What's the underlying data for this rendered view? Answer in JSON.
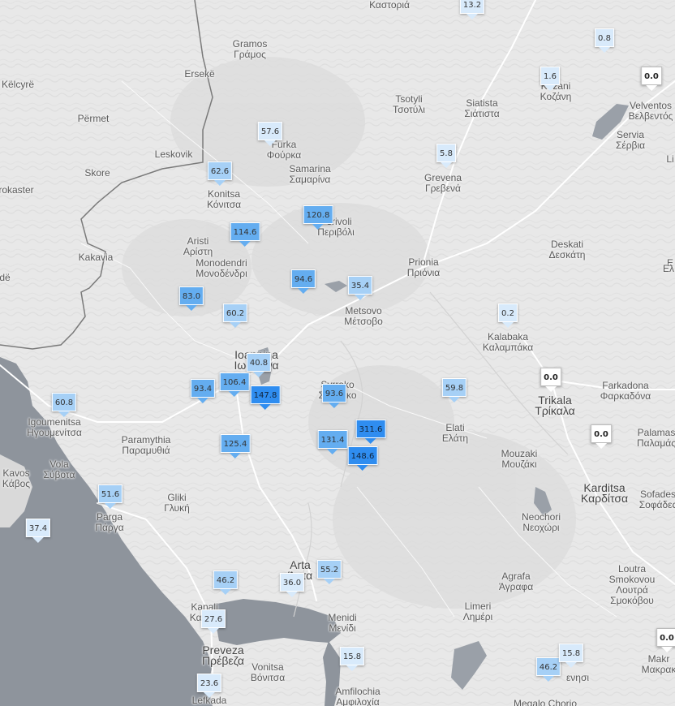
{
  "colors": {
    "land": "#e8e8e8",
    "sea": "#8e949c",
    "water": "#9aa0a8",
    "border": "#7a7a7a",
    "road": "#ffffff",
    "rain_zero": "#ffffff",
    "rain_low": "#d8eafb",
    "rain_mid": "#a6d0f6",
    "rain_high": "#64adf0",
    "rain_max": "#2f8df0"
  },
  "places": [
    {
      "id": "gramos",
      "lines": [
        "Gramos",
        "Γράμος"
      ]
    },
    {
      "id": "ersekë",
      "lines": [
        "Ersekë"
      ]
    },
    {
      "id": "kelcyre",
      "lines": [
        "Këlcyrë"
      ]
    },
    {
      "id": "permet",
      "lines": [
        "Përmet"
      ]
    },
    {
      "id": "leskovik",
      "lines": [
        "Leskovik"
      ]
    },
    {
      "id": "skore",
      "lines": [
        "Skore"
      ]
    },
    {
      "id": "rokaster",
      "lines": [
        "rokaster"
      ]
    },
    {
      "id": "kakavia",
      "lines": [
        "Kakavia"
      ]
    },
    {
      "id": "de",
      "lines": [
        "dë"
      ]
    },
    {
      "id": "furka",
      "lines": [
        "Furka",
        "Φούρκα"
      ]
    },
    {
      "id": "samarina",
      "lines": [
        "Samarina",
        "Σαμαρίνα"
      ]
    },
    {
      "id": "konitsa",
      "lines": [
        "Konitsa",
        "Κόνιτσα"
      ]
    },
    {
      "id": "aristi",
      "lines": [
        "Aristi",
        "Αρίστη"
      ]
    },
    {
      "id": "monodendri",
      "lines": [
        "Monodendri",
        "Μονοδένδρι"
      ]
    },
    {
      "id": "perivoli",
      "lines": [
        "Perivoli",
        "Περιβόλι"
      ]
    },
    {
      "id": "tsotyli",
      "lines": [
        "Tsotyli",
        "Τσοτύλι"
      ]
    },
    {
      "id": "siatista",
      "lines": [
        "Siatista",
        "Σιάτιστα"
      ]
    },
    {
      "id": "kozani",
      "lines": [
        "Kozani",
        "Κοζάνη"
      ]
    },
    {
      "id": "velventos",
      "lines": [
        "Velventos",
        "Βελβεντός"
      ]
    },
    {
      "id": "servia",
      "lines": [
        "Servia",
        "Σέρβια"
      ]
    },
    {
      "id": "grevena",
      "lines": [
        "Grevena",
        "Γρεβενά"
      ]
    },
    {
      "id": "deskati",
      "lines": [
        "Deskati",
        "Δεσκάτη"
      ]
    },
    {
      "id": "prionia",
      "lines": [
        "Prionia",
        "Πριόνια"
      ]
    },
    {
      "id": "metsovo",
      "lines": [
        "Metsovo",
        "Μέτσοβο"
      ]
    },
    {
      "id": "kalabaka",
      "lines": [
        "Kalabaka",
        "Καλαμπάκα"
      ]
    },
    {
      "id": "ioannina",
      "lines": [
        "Ioannina",
        "Ιωάννινα"
      ],
      "big": true
    },
    {
      "id": "syrrako",
      "lines": [
        "Syrrako",
        "Συρράκο"
      ]
    },
    {
      "id": "trikala",
      "lines": [
        "Trikala",
        "Τρίκαλα"
      ],
      "big": true
    },
    {
      "id": "farkadona",
      "lines": [
        "Farkadona",
        "Φαρκαδόνα"
      ]
    },
    {
      "id": "elati",
      "lines": [
        "Elati",
        "Ελάτη"
      ]
    },
    {
      "id": "igoumenitsa",
      "lines": [
        "Igoumenitsa",
        "Ηγουμενίτσα"
      ]
    },
    {
      "id": "paramythia",
      "lines": [
        "Paramythia",
        "Παραμυθιά"
      ]
    },
    {
      "id": "mouzaki",
      "lines": [
        "Mouzaki",
        "Μουζάκι"
      ]
    },
    {
      "id": "palamas",
      "lines": [
        "Palamas",
        "Παλαμάς"
      ]
    },
    {
      "id": "karditsa",
      "lines": [
        "Karditsa",
        "Καρδίτσα"
      ],
      "big": true
    },
    {
      "id": "sofades",
      "lines": [
        "Sofades",
        "Σοφάδες"
      ]
    },
    {
      "id": "kavos",
      "lines": [
        "Kavos",
        "Κάβος"
      ]
    },
    {
      "id": "vola",
      "lines": [
        "Vola",
        "Σύβοτα"
      ]
    },
    {
      "id": "parga",
      "lines": [
        "Parga",
        "Πάργα"
      ]
    },
    {
      "id": "gliki",
      "lines": [
        "Gliki",
        "Γλυκή"
      ]
    },
    {
      "id": "neochori",
      "lines": [
        "Neochori",
        "Νεοχώρι"
      ]
    },
    {
      "id": "arta",
      "lines": [
        "Arta",
        "Άρτα"
      ],
      "big": true
    },
    {
      "id": "kanali",
      "lines": [
        "Kanali",
        "Καναλι"
      ]
    },
    {
      "id": "menidi",
      "lines": [
        "Menidi",
        "Μενίδι"
      ]
    },
    {
      "id": "agrafa",
      "lines": [
        "Agrafa",
        "Άγραφα"
      ]
    },
    {
      "id": "limeri",
      "lines": [
        "Limeri",
        "Λημέρι"
      ]
    },
    {
      "id": "loutra",
      "lines": [
        "Loutra",
        "Smokovou",
        "Λουτρά",
        "Σμοκόβου"
      ]
    },
    {
      "id": "preveza",
      "lines": [
        "Preveza",
        "Πρέβεζα"
      ],
      "big": true
    },
    {
      "id": "vonitsa",
      "lines": [
        "Vonitsa",
        "Βόνιτσα"
      ]
    },
    {
      "id": "amfilochia",
      "lines": [
        "Amfilochia",
        "Αμφιλοχία"
      ]
    },
    {
      "id": "lefkada",
      "lines": [
        "Lefkada"
      ]
    },
    {
      "id": "megalo",
      "lines": [
        "Megalo Chorio"
      ]
    },
    {
      "id": "makrakomi",
      "lines": [
        "Makr",
        "Μακρακ"
      ]
    },
    {
      "id": "venisi",
      "lines": [
        "ενησι"
      ]
    },
    {
      "id": "kastoria",
      "lines": [
        "Καστοριά"
      ]
    },
    {
      "id": "agiaso",
      "lines": [
        "Φούρκα"
      ]
    },
    {
      "id": "el",
      "lines": [
        "Ε"
      ]
    },
    {
      "id": "li",
      "lines": [
        "Li"
      ]
    },
    {
      "id": "elli",
      "lines": [
        "Ελ"
      ]
    }
  ],
  "rain_markers": [
    {
      "value": "13.2",
      "tier": "low"
    },
    {
      "value": "0.8",
      "tier": "low"
    },
    {
      "value": "1.6",
      "tier": "low"
    },
    {
      "value": "0.0",
      "tier": "zero"
    },
    {
      "value": "57.6",
      "tier": "low"
    },
    {
      "value": "62.6",
      "tier": "mid"
    },
    {
      "value": "5.8",
      "tier": "low"
    },
    {
      "value": "120.8",
      "tier": "high"
    },
    {
      "value": "114.6",
      "tier": "high"
    },
    {
      "value": "94.6",
      "tier": "high"
    },
    {
      "value": "35.4",
      "tier": "mid"
    },
    {
      "value": "83.0",
      "tier": "high"
    },
    {
      "value": "60.2",
      "tier": "mid"
    },
    {
      "value": "0.2",
      "tier": "low"
    },
    {
      "value": "40.8",
      "tier": "mid"
    },
    {
      "value": "106.4",
      "tier": "high"
    },
    {
      "value": "93.4",
      "tier": "high"
    },
    {
      "value": "147.8",
      "tier": "max"
    },
    {
      "value": "93.6",
      "tier": "high"
    },
    {
      "value": "59.8",
      "tier": "mid"
    },
    {
      "value": "0.0",
      "tier": "zero"
    },
    {
      "value": "60.8",
      "tier": "mid"
    },
    {
      "value": "311.6",
      "tier": "max"
    },
    {
      "value": "131.4",
      "tier": "high"
    },
    {
      "value": "148.6",
      "tier": "max"
    },
    {
      "value": "0.0",
      "tier": "zero"
    },
    {
      "value": "125.4",
      "tier": "high"
    },
    {
      "value": "51.6",
      "tier": "mid"
    },
    {
      "value": "37.4",
      "tier": "low"
    },
    {
      "value": "46.2",
      "tier": "mid"
    },
    {
      "value": "36.0",
      "tier": "low"
    },
    {
      "value": "55.2",
      "tier": "mid"
    },
    {
      "value": "27.6",
      "tier": "low"
    },
    {
      "value": "15.8",
      "tier": "low"
    },
    {
      "value": "46.2",
      "tier": "mid"
    },
    {
      "value": "15.8",
      "tier": "low"
    },
    {
      "value": "0.0",
      "tier": "zero"
    },
    {
      "value": "23.6",
      "tier": "low"
    }
  ]
}
